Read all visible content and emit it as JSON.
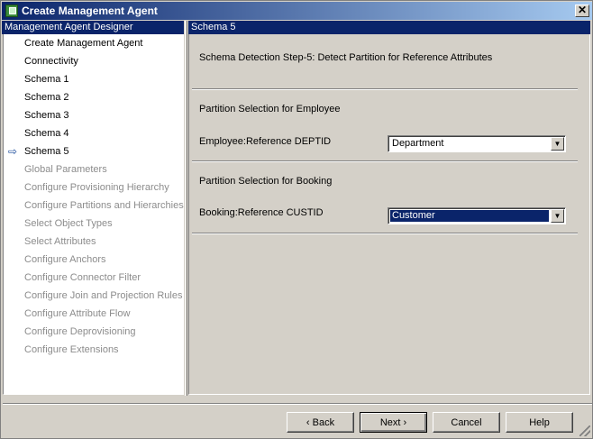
{
  "window": {
    "title": "Create Management Agent",
    "close_glyph": "✕"
  },
  "left_panel": {
    "header": "Management Agent Designer",
    "current_indicator_glyph": "⇨",
    "items": [
      {
        "label": "Create Management Agent",
        "enabled": true
      },
      {
        "label": "Connectivity",
        "enabled": true
      },
      {
        "label": "Schema 1",
        "enabled": true
      },
      {
        "label": "Schema 2",
        "enabled": true
      },
      {
        "label": "Schema 3",
        "enabled": true
      },
      {
        "label": "Schema 4",
        "enabled": true
      },
      {
        "label": "Schema 5",
        "enabled": true,
        "current": true
      },
      {
        "label": "Global Parameters",
        "enabled": false
      },
      {
        "label": "Configure Provisioning Hierarchy",
        "enabled": false
      },
      {
        "label": "Configure Partitions and Hierarchies",
        "enabled": false
      },
      {
        "label": "Select Object Types",
        "enabled": false
      },
      {
        "label": "Select Attributes",
        "enabled": false
      },
      {
        "label": "Configure Anchors",
        "enabled": false
      },
      {
        "label": "Configure Connector Filter",
        "enabled": false
      },
      {
        "label": "Configure Join and Projection Rules",
        "enabled": false
      },
      {
        "label": "Configure Attribute Flow",
        "enabled": false
      },
      {
        "label": "Configure Deprovisioning",
        "enabled": false
      },
      {
        "label": "Configure Extensions",
        "enabled": false
      }
    ]
  },
  "right_panel": {
    "header": "Schema 5",
    "step_title": "Schema Detection Step-5: Detect Partition for Reference Attributes",
    "sections": [
      {
        "title": "Partition Selection for Employee",
        "field_label": "Employee:Reference DEPTID",
        "selected_value": "Department"
      },
      {
        "title": "Partition Selection for Booking",
        "field_label": "Booking:Reference CUSTID",
        "selected_value": "Customer"
      }
    ],
    "dropdown_glyph": "▼"
  },
  "buttons": {
    "back": "‹  Back",
    "next": "Next  ›",
    "cancel": "Cancel",
    "help": "Help"
  },
  "colors": {
    "titlebar_start": "#0a246a",
    "titlebar_end": "#a6caf0",
    "panel_header": "#0a246a",
    "face": "#d4d0c8",
    "disabled_text": "#8c8c8c"
  }
}
